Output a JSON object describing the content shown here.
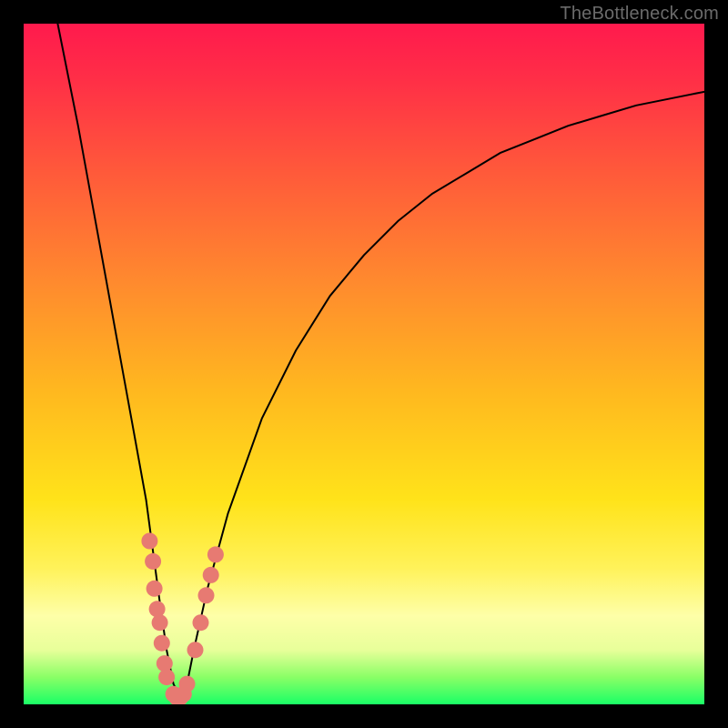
{
  "watermark": "TheBottleneck.com",
  "chart_data": {
    "type": "line",
    "title": "",
    "xlabel": "",
    "ylabel": "",
    "xlim": [
      0,
      100
    ],
    "ylim": [
      0,
      100
    ],
    "grid": false,
    "series": [
      {
        "name": "bottleneck-curve",
        "x": [
          5,
          8,
          10,
          12,
          14,
          16,
          18,
          20,
          21,
          22,
          23,
          24,
          25,
          27,
          30,
          35,
          40,
          45,
          50,
          55,
          60,
          65,
          70,
          75,
          80,
          85,
          90,
          95,
          100
        ],
        "y": [
          100,
          85,
          74,
          63,
          52,
          41,
          30,
          15,
          8,
          3,
          1,
          3,
          8,
          17,
          28,
          42,
          52,
          60,
          66,
          71,
          75,
          78,
          81,
          83,
          85,
          86.5,
          88,
          89,
          90
        ]
      }
    ],
    "markers": [
      {
        "x": 18.5,
        "y": 24
      },
      {
        "x": 19.0,
        "y": 21
      },
      {
        "x": 19.2,
        "y": 17
      },
      {
        "x": 19.6,
        "y": 14
      },
      {
        "x": 20.0,
        "y": 12
      },
      {
        "x": 20.3,
        "y": 9
      },
      {
        "x": 20.7,
        "y": 6
      },
      {
        "x": 21.0,
        "y": 4
      },
      {
        "x": 22.0,
        "y": 1.5
      },
      {
        "x": 22.5,
        "y": 1
      },
      {
        "x": 23.0,
        "y": 1
      },
      {
        "x": 23.5,
        "y": 1.5
      },
      {
        "x": 24.0,
        "y": 3
      },
      {
        "x": 25.2,
        "y": 8
      },
      {
        "x": 26.0,
        "y": 12
      },
      {
        "x": 26.8,
        "y": 16
      },
      {
        "x": 27.5,
        "y": 19
      },
      {
        "x": 28.2,
        "y": 22
      }
    ],
    "marker_color": "#e77a72",
    "curve_color": "#000000"
  }
}
